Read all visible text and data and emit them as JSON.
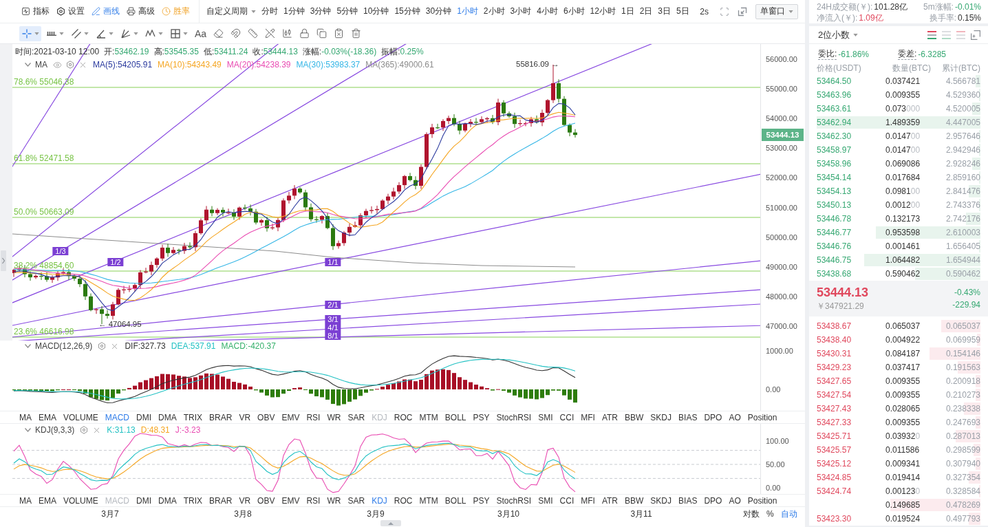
{
  "toolbar": {
    "tools": [
      {
        "label": "指标",
        "kind": "indicators",
        "selected": false
      },
      {
        "label": "设置",
        "kind": "settings",
        "selected": false
      },
      {
        "label": "画线",
        "kind": "draw",
        "selected": true
      },
      {
        "label": "高级",
        "kind": "advanced",
        "selected": false
      },
      {
        "label": "胜率",
        "kind": "winrate",
        "selected": false
      }
    ],
    "custom_period": "自定义周期",
    "periods": [
      {
        "label": "分时",
        "selected": false
      },
      {
        "label": "1分钟",
        "selected": false
      },
      {
        "label": "3分钟",
        "selected": false
      },
      {
        "label": "5分钟",
        "selected": false
      },
      {
        "label": "10分钟",
        "selected": false
      },
      {
        "label": "15分钟",
        "selected": false
      },
      {
        "label": "30分钟",
        "selected": false
      },
      {
        "label": "1小时",
        "selected": true
      },
      {
        "label": "2小时",
        "selected": false
      },
      {
        "label": "3小时",
        "selected": false
      },
      {
        "label": "4小时",
        "selected": false
      },
      {
        "label": "6小时",
        "selected": false
      },
      {
        "label": "12小时",
        "selected": false
      },
      {
        "label": "1日",
        "selected": false
      },
      {
        "label": "2日",
        "selected": false
      },
      {
        "label": "3日",
        "selected": false
      },
      {
        "label": "5日",
        "selected": false
      }
    ],
    "interval": "2s",
    "window_mode": "单窗口"
  },
  "drawing_tools": [
    {
      "kind": "crosshair",
      "selected": true,
      "has_menu": true
    },
    {
      "kind": "horizontal-line",
      "selected": false,
      "has_menu": true
    },
    {
      "kind": "parallel",
      "selected": false,
      "has_menu": true
    },
    {
      "kind": "angle",
      "selected": false,
      "has_menu": true
    },
    {
      "kind": "fan",
      "selected": false,
      "has_menu": true
    },
    {
      "kind": "wave",
      "selected": false,
      "has_menu": true
    },
    {
      "kind": "grid",
      "selected": false,
      "has_menu": true
    },
    {
      "kind": "text",
      "label": "Aa",
      "selected": false,
      "has_menu": false
    },
    {
      "kind": "eraser",
      "selected": false,
      "has_menu": false
    },
    {
      "kind": "magnet",
      "selected": false,
      "has_menu": false
    },
    {
      "kind": "ruler",
      "selected": false,
      "has_menu": false
    },
    {
      "kind": "pencil-off",
      "selected": false,
      "has_menu": false
    },
    {
      "kind": "candles",
      "selected": false,
      "has_menu": false
    },
    {
      "kind": "lock",
      "selected": false,
      "has_menu": false
    },
    {
      "kind": "copy",
      "selected": false,
      "has_menu": false
    },
    {
      "kind": "clear",
      "selected": false,
      "has_menu": false
    },
    {
      "kind": "trash",
      "selected": false,
      "has_menu": false
    }
  ],
  "chart": {
    "info": [
      {
        "label": "时间:",
        "value": "2021-03-10 12:00",
        "color": "#333333"
      },
      {
        "label": "开:",
        "value": "53462.19",
        "color": "#36a872"
      },
      {
        "label": "高:",
        "value": "53545.35",
        "color": "#36a872"
      },
      {
        "label": "低:",
        "value": "53411.24",
        "color": "#36a872"
      },
      {
        "label": "收:",
        "value": "53444.13",
        "color": "#36a872"
      },
      {
        "label": "涨幅:",
        "value": "-0.03%(-18.36)",
        "color": "#36a872"
      },
      {
        "label": "振幅:",
        "value": "0.25%",
        "color": "#36a872"
      }
    ],
    "ma_legend": {
      "name": "MA",
      "series": [
        {
          "label": "MA(5):54205.91",
          "color": "#2b3a9e"
        },
        {
          "label": "MA(10):54343.49",
          "color": "#f5a623"
        },
        {
          "label": "MA(20):54238.39",
          "color": "#e94bb2"
        },
        {
          "label": "MA(30):53983.37",
          "color": "#35b6e6"
        },
        {
          "label": "MA(365):49000.61",
          "color": "#8c8c8c"
        }
      ]
    },
    "fib_levels": [
      "78.6% 55046.38",
      "61.8% 52471.58",
      "50.0% 50663.09",
      "38.2% 48854.60",
      "23.6% 46616.98"
    ],
    "fan_labels": [
      "1/3",
      "1/2",
      "1/1",
      "2/1",
      "3/1",
      "4/1",
      "8/1"
    ],
    "annotations": [
      "55816.09 →",
      "← 47064.95"
    ],
    "y_axis": [
      "56000.00",
      "55000.00",
      "54000.00",
      "53000.00",
      "52000.00",
      "51000.00",
      "50000.00",
      "49000.00",
      "48000.00",
      "47000.00"
    ],
    "last_price_tag": "53444.13"
  },
  "macd": {
    "name": "MACD(12,26,9)",
    "values": [
      {
        "label": "DIF:327.73",
        "color": "#333333"
      },
      {
        "label": "DEA:537.91",
        "color": "#22c1c3"
      },
      {
        "label": "MACD:-420.37",
        "color": "#35b06a"
      }
    ],
    "y_axis": [
      "1000.00",
      "0.00"
    ]
  },
  "macd_tabs": [
    {
      "label": "MA",
      "selected": false,
      "disabled": false
    },
    {
      "label": "EMA",
      "selected": false,
      "disabled": false
    },
    {
      "label": "VOLUME",
      "selected": false,
      "disabled": false
    },
    {
      "label": "MACD",
      "selected": true,
      "disabled": false
    },
    {
      "label": "DMI",
      "selected": false,
      "disabled": false
    },
    {
      "label": "DMA",
      "selected": false,
      "disabled": false
    },
    {
      "label": "TRIX",
      "selected": false,
      "disabled": false
    },
    {
      "label": "BRAR",
      "selected": false,
      "disabled": false
    },
    {
      "label": "VR",
      "selected": false,
      "disabled": false
    },
    {
      "label": "OBV",
      "selected": false,
      "disabled": false
    },
    {
      "label": "EMV",
      "selected": false,
      "disabled": false
    },
    {
      "label": "RSI",
      "selected": false,
      "disabled": false
    },
    {
      "label": "WR",
      "selected": false,
      "disabled": false
    },
    {
      "label": "SAR",
      "selected": false,
      "disabled": false
    },
    {
      "label": "KDJ",
      "selected": false,
      "disabled": true
    },
    {
      "label": "ROC",
      "selected": false,
      "disabled": false
    },
    {
      "label": "MTM",
      "selected": false,
      "disabled": false
    },
    {
      "label": "BOLL",
      "selected": false,
      "disabled": false
    },
    {
      "label": "PSY",
      "selected": false,
      "disabled": false
    },
    {
      "label": "StochRSI",
      "selected": false,
      "disabled": false
    },
    {
      "label": "SMI",
      "selected": false,
      "disabled": false
    },
    {
      "label": "CCI",
      "selected": false,
      "disabled": false
    },
    {
      "label": "MFI",
      "selected": false,
      "disabled": false
    },
    {
      "label": "ATR",
      "selected": false,
      "disabled": false
    },
    {
      "label": "BBW",
      "selected": false,
      "disabled": false
    },
    {
      "label": "SKDJ",
      "selected": false,
      "disabled": false
    },
    {
      "label": "BIAS",
      "selected": false,
      "disabled": false
    },
    {
      "label": "DPO",
      "selected": false,
      "disabled": false
    },
    {
      "label": "AO",
      "selected": false,
      "disabled": false
    },
    {
      "label": "Position",
      "selected": false,
      "disabled": false
    }
  ],
  "kdj": {
    "name": "KDJ(9,3,3)",
    "values": [
      {
        "label": "K:31.13",
        "color": "#22c1c3"
      },
      {
        "label": "D:48.31",
        "color": "#f5a623"
      },
      {
        "label": "J:-3.23",
        "color": "#e94bb2"
      }
    ],
    "y_axis": [
      "100.00",
      "50.00",
      "0.00"
    ]
  },
  "kdj_tabs": [
    {
      "label": "MA",
      "selected": false,
      "disabled": false
    },
    {
      "label": "EMA",
      "selected": false,
      "disabled": false
    },
    {
      "label": "VOLUME",
      "selected": false,
      "disabled": false
    },
    {
      "label": "MACD",
      "selected": false,
      "disabled": true
    },
    {
      "label": "DMI",
      "selected": false,
      "disabled": false
    },
    {
      "label": "DMA",
      "selected": false,
      "disabled": false
    },
    {
      "label": "TRIX",
      "selected": false,
      "disabled": false
    },
    {
      "label": "BRAR",
      "selected": false,
      "disabled": false
    },
    {
      "label": "VR",
      "selected": false,
      "disabled": false
    },
    {
      "label": "OBV",
      "selected": false,
      "disabled": false
    },
    {
      "label": "EMV",
      "selected": false,
      "disabled": false
    },
    {
      "label": "RSI",
      "selected": false,
      "disabled": false
    },
    {
      "label": "WR",
      "selected": false,
      "disabled": false
    },
    {
      "label": "SAR",
      "selected": false,
      "disabled": false
    },
    {
      "label": "KDJ",
      "selected": true,
      "disabled": false
    },
    {
      "label": "ROC",
      "selected": false,
      "disabled": false
    },
    {
      "label": "MTM",
      "selected": false,
      "disabled": false
    },
    {
      "label": "BOLL",
      "selected": false,
      "disabled": false
    },
    {
      "label": "PSY",
      "selected": false,
      "disabled": false
    },
    {
      "label": "StochRSI",
      "selected": false,
      "disabled": false
    },
    {
      "label": "SMI",
      "selected": false,
      "disabled": false
    },
    {
      "label": "CCI",
      "selected": false,
      "disabled": false
    },
    {
      "label": "MFI",
      "selected": false,
      "disabled": false
    },
    {
      "label": "ATR",
      "selected": false,
      "disabled": false
    },
    {
      "label": "BBW",
      "selected": false,
      "disabled": false
    },
    {
      "label": "SKDJ",
      "selected": false,
      "disabled": false
    },
    {
      "label": "BIAS",
      "selected": false,
      "disabled": false
    },
    {
      "label": "DPO",
      "selected": false,
      "disabled": false
    },
    {
      "label": "AO",
      "selected": false,
      "disabled": false
    },
    {
      "label": "Position",
      "selected": false,
      "disabled": false
    }
  ],
  "date_axis": [
    "3月7",
    "3月8",
    "3月9",
    "3月10",
    "3月11"
  ],
  "scale_modes": [
    {
      "label": "对数",
      "selected": false
    },
    {
      "label": "%",
      "selected": false
    },
    {
      "label": "自动",
      "selected": true
    }
  ],
  "order_book": {
    "stats": [
      {
        "label": "24H成交额(￥):",
        "value": "101.28亿",
        "color": "#333333"
      },
      {
        "label": "5m涨幅:",
        "value": "-0.01%",
        "color": "#36a872"
      },
      {
        "label": "净流入(￥):",
        "value": "1.09亿",
        "color": "#e0485d"
      },
      {
        "label": "换手率:",
        "value": "0.15%",
        "color": "#333333"
      }
    ],
    "precision": "2位小数",
    "views": [
      {
        "kind": "both",
        "selected": true
      },
      {
        "kind": "bids",
        "selected": false
      },
      {
        "kind": "asks",
        "selected": false
      }
    ],
    "ratio": {
      "label": "委比:",
      "value": "-61.86%"
    },
    "difference": {
      "label": "委差:",
      "value": "-6.3285"
    },
    "columns": [
      "价格(USDT)",
      "数量(BTC)",
      "累计(BTC)"
    ],
    "asks": [
      {
        "price": "53464.50",
        "quantity": "0.037421",
        "total": "4.566781",
        "level": 0.03
      },
      {
        "price": "53463.96",
        "quantity": "0.009355",
        "total": "4.529360",
        "level": 0.01
      },
      {
        "price": "53463.61",
        "quantity": "0.073000",
        "total": "4.520005",
        "level": 0.05
      },
      {
        "price": "53462.94",
        "quantity": "1.489359",
        "total": "4.447005",
        "level": 1.0
      },
      {
        "price": "53462.30",
        "quantity": "0.014700",
        "total": "2.957646",
        "level": 0.01
      },
      {
        "price": "53458.97",
        "quantity": "0.014700",
        "total": "2.942946",
        "level": 0.01
      },
      {
        "price": "53458.96",
        "quantity": "0.069086",
        "total": "2.928246",
        "level": 0.05
      },
      {
        "price": "53454.14",
        "quantity": "0.017684",
        "total": "2.859160",
        "level": 0.01
      },
      {
        "price": "53454.13",
        "quantity": "0.098100",
        "total": "2.841476",
        "level": 0.07
      },
      {
        "price": "53450.13",
        "quantity": "0.001200",
        "total": "2.743376",
        "level": 0.01
      },
      {
        "price": "53446.78",
        "quantity": "0.132173",
        "total": "2.742176",
        "level": 0.09
      },
      {
        "price": "53446.77",
        "quantity": "0.953598",
        "total": "2.610003",
        "level": 0.64
      },
      {
        "price": "53446.76",
        "quantity": "0.001461",
        "total": "1.656405",
        "level": 0.01
      },
      {
        "price": "53446.75",
        "quantity": "1.064482",
        "total": "1.654944",
        "level": 0.71
      },
      {
        "price": "53438.68",
        "quantity": "0.590462",
        "total": "0.590462",
        "level": 0.4
      }
    ],
    "last_price": {
      "price": "53444.13",
      "price_up": true,
      "cny": "￥347921.29",
      "change_pct": "-0.43%",
      "change": "-229.94",
      "change_up": false
    },
    "bids": [
      {
        "price": "53438.67",
        "quantity": "0.065037",
        "total": "0.065037",
        "level": 0.24
      },
      {
        "price": "53438.40",
        "quantity": "0.004922",
        "total": "0.069959",
        "level": 0.02
      },
      {
        "price": "53430.31",
        "quantity": "0.084187",
        "total": "0.154146",
        "level": 0.31
      },
      {
        "price": "53429.23",
        "quantity": "0.037417",
        "total": "0.191563",
        "level": 0.14
      },
      {
        "price": "53427.65",
        "quantity": "0.009355",
        "total": "0.200918",
        "level": 0.03
      },
      {
        "price": "53427.54",
        "quantity": "0.009355",
        "total": "0.210273",
        "level": 0.03
      },
      {
        "price": "53427.43",
        "quantity": "0.028065",
        "total": "0.238338",
        "level": 0.1
      },
      {
        "price": "53427.33",
        "quantity": "0.009355",
        "total": "0.247693",
        "level": 0.03
      },
      {
        "price": "53425.71",
        "quantity": "0.039320",
        "total": "0.287013",
        "level": 0.15
      },
      {
        "price": "53425.57",
        "quantity": "0.011586",
        "total": "0.298599",
        "level": 0.04
      },
      {
        "price": "53425.12",
        "quantity": "0.009341",
        "total": "0.307940",
        "level": 0.03
      },
      {
        "price": "53424.85",
        "quantity": "0.019414",
        "total": "0.327354",
        "level": 0.07
      },
      {
        "price": "53424.74",
        "quantity": "0.001230",
        "total": "0.328584",
        "level": 0.01
      },
      {
        "quantity": "0.149685",
        "total": "0.478269",
        "level": 0.55
      },
      {
        "price": "53423.30",
        "quantity": "0.019524",
        "total": "0.497793",
        "level": 0.07
      }
    ]
  }
}
